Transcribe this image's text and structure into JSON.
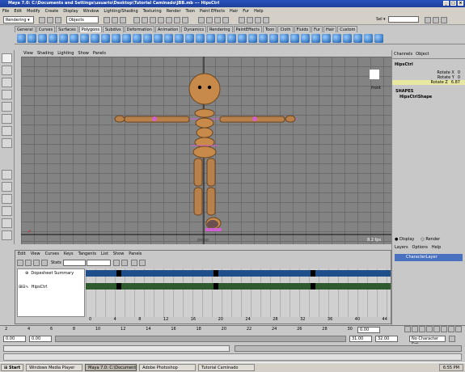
{
  "window": {
    "title": "Maya 7.0: C:\\Documents and Settings\\usuario\\Desktop\\Tutorial Caminado\\JBB.mb  ---  HipsCtrl"
  },
  "menu": [
    "File",
    "Edit",
    "Modify",
    "Create",
    "Display",
    "Window",
    "Lighting/Shading",
    "Texturing",
    "Render",
    "Toon",
    "Paint Effects",
    "Hair",
    "Fur",
    "Help"
  ],
  "status": {
    "mode": "Rendering",
    "objects_label": "Objects",
    "sel_label": "Sel"
  },
  "shelf_tabs": [
    "General",
    "Curves",
    "Surfaces",
    "Polygons",
    "Subdivs",
    "Deformation",
    "Animation",
    "Dynamics",
    "Rendering",
    "PaintEffects",
    "Toon",
    "Cloth",
    "Fluids",
    "Fur",
    "Hair",
    "Custom"
  ],
  "active_shelf": "Polygons",
  "viewport": {
    "menu": [
      "View",
      "Shading",
      "Lighting",
      "Show",
      "Panels"
    ],
    "camera": "persp",
    "fps": "8.2 fps",
    "cube_label": "front"
  },
  "channel_box": {
    "tabs": [
      "Channels",
      "Object"
    ],
    "object": "HipsCtrl",
    "attrs": [
      {
        "name": "Rotate X",
        "value": "0"
      },
      {
        "name": "Rotate Y",
        "value": "0"
      },
      {
        "name": "Rotate Z",
        "value": "6.87"
      }
    ],
    "shapes_label": "SHAPES",
    "shape": "HipsCtrlShape"
  },
  "layer_editor": {
    "tabs": [
      "Display",
      "Render"
    ],
    "menu": [
      "Layers",
      "Options",
      "Help"
    ],
    "layer": "CharacterLayer"
  },
  "dope": {
    "menu": [
      "Edit",
      "View",
      "Curves",
      "Keys",
      "Tangents",
      "List",
      "Show",
      "Panels"
    ],
    "stats_label": "Stats",
    "summary": "Dopesheet Summary",
    "node": "HipsCtrl",
    "ticks": [
      "0",
      "4",
      "8",
      "12",
      "16",
      "20",
      "24",
      "28",
      "32",
      "36",
      "40",
      "44"
    ]
  },
  "time": {
    "ticks": [
      "2",
      "4",
      "6",
      "8",
      "10",
      "12",
      "14",
      "16",
      "18",
      "20",
      "22",
      "24",
      "26",
      "28",
      "30"
    ],
    "current": "0.00",
    "start": "0.00",
    "end": "0.00",
    "range_start": "31.00",
    "range_end": "32.00",
    "char_set": "No Character Set"
  },
  "taskbar": {
    "start": "Start",
    "items": [
      "Windows Media Player",
      "Maya 7.0: C:\\Document...",
      "Adobe Photoshop",
      "Tutorial Caminado"
    ],
    "clock": "6:55 PM"
  },
  "colors": {
    "accent": "#1e3f9a",
    "dope_blue": "#1f4f8a",
    "dope_green": "#2e5a2e",
    "character": "#c88a4a"
  }
}
